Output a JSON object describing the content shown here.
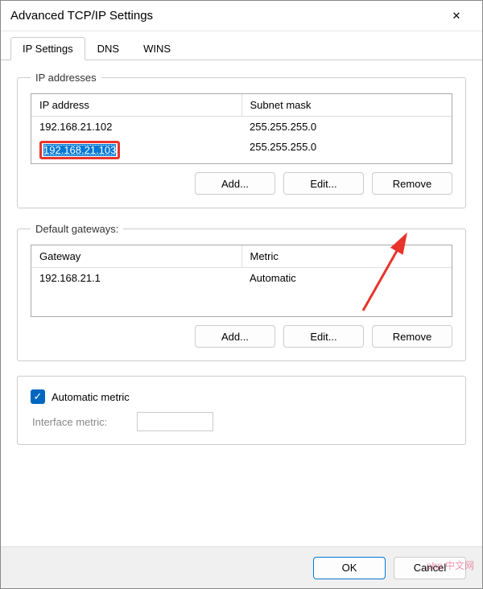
{
  "title": "Advanced TCP/IP Settings",
  "tabs": [
    {
      "label": "IP Settings",
      "active": true
    },
    {
      "label": "DNS",
      "active": false
    },
    {
      "label": "WINS",
      "active": false
    }
  ],
  "ipAddresses": {
    "legend": "IP addresses",
    "headers": {
      "col1": "IP address",
      "col2": "Subnet mask"
    },
    "rows": [
      {
        "ip": "192.168.21.102",
        "mask": "255.255.255.0",
        "selected": false
      },
      {
        "ip": "192.168.21.103",
        "mask": "255.255.255.0",
        "selected": true
      }
    ],
    "buttons": {
      "add": "Add...",
      "edit": "Edit...",
      "remove": "Remove"
    }
  },
  "gateways": {
    "legend": "Default gateways:",
    "headers": {
      "col1": "Gateway",
      "col2": "Metric"
    },
    "rows": [
      {
        "gw": "192.168.21.1",
        "metric": "Automatic"
      }
    ],
    "buttons": {
      "add": "Add...",
      "edit": "Edit...",
      "remove": "Remove"
    }
  },
  "metric": {
    "autoLabel": "Automatic metric",
    "autoChecked": true,
    "interfaceLabel": "Interface metric:",
    "interfaceValue": ""
  },
  "footer": {
    "ok": "OK",
    "cancel": "Cancel"
  },
  "watermark": "php 中文网"
}
